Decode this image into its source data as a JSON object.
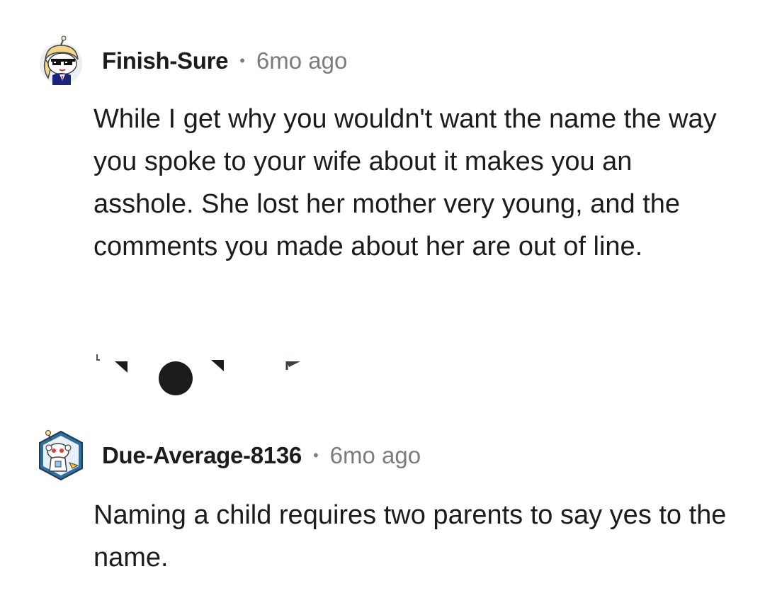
{
  "comments": [
    {
      "author": "Finish-Sure",
      "separator": "•",
      "time": "6mo ago",
      "avatar_icon": "snoo-avatar-sunglasses-icon",
      "text": "While I get why you wouldn't want the name the way you spoke to your wife about it makes you an asshole. She lost her mother very young, and the comments you made about her are out of line."
    },
    {
      "author": "Due-Average-8136",
      "separator": "•",
      "time": "6mo ago",
      "avatar_icon": "snoo-avatar-robot-icon",
      "text": "Naming a child requires two parents to say yes to the name."
    }
  ],
  "colors": {
    "text": "#1c1c1c",
    "meta": "#7c7c7c",
    "background": "#ffffff"
  }
}
